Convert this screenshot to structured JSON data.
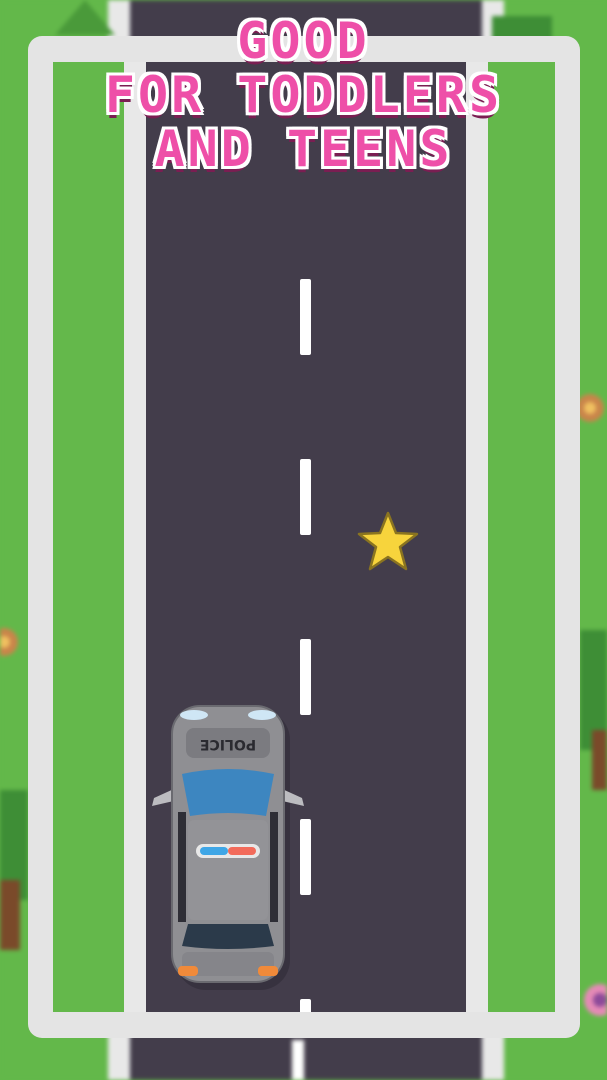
{
  "title": {
    "line1": "GOOD",
    "line2": "FOR TODDLERS",
    "line3": "AND TEENS"
  },
  "car": {
    "label": "POLICE",
    "body_color": "#8f8f93",
    "window_color": "#3d86c0",
    "light_left_color": "#3fa6e6",
    "light_right_color": "#f26b5b"
  },
  "colors": {
    "grass": "#64b84b",
    "road": "#433d4b",
    "curb": "#e8e8e8",
    "frame": "#e4e4e4",
    "title_fill": "#ee4fa8",
    "star": "#f7d43c"
  },
  "icons": [
    "star-icon",
    "police-car",
    "tree-icon",
    "flower-icon"
  ]
}
